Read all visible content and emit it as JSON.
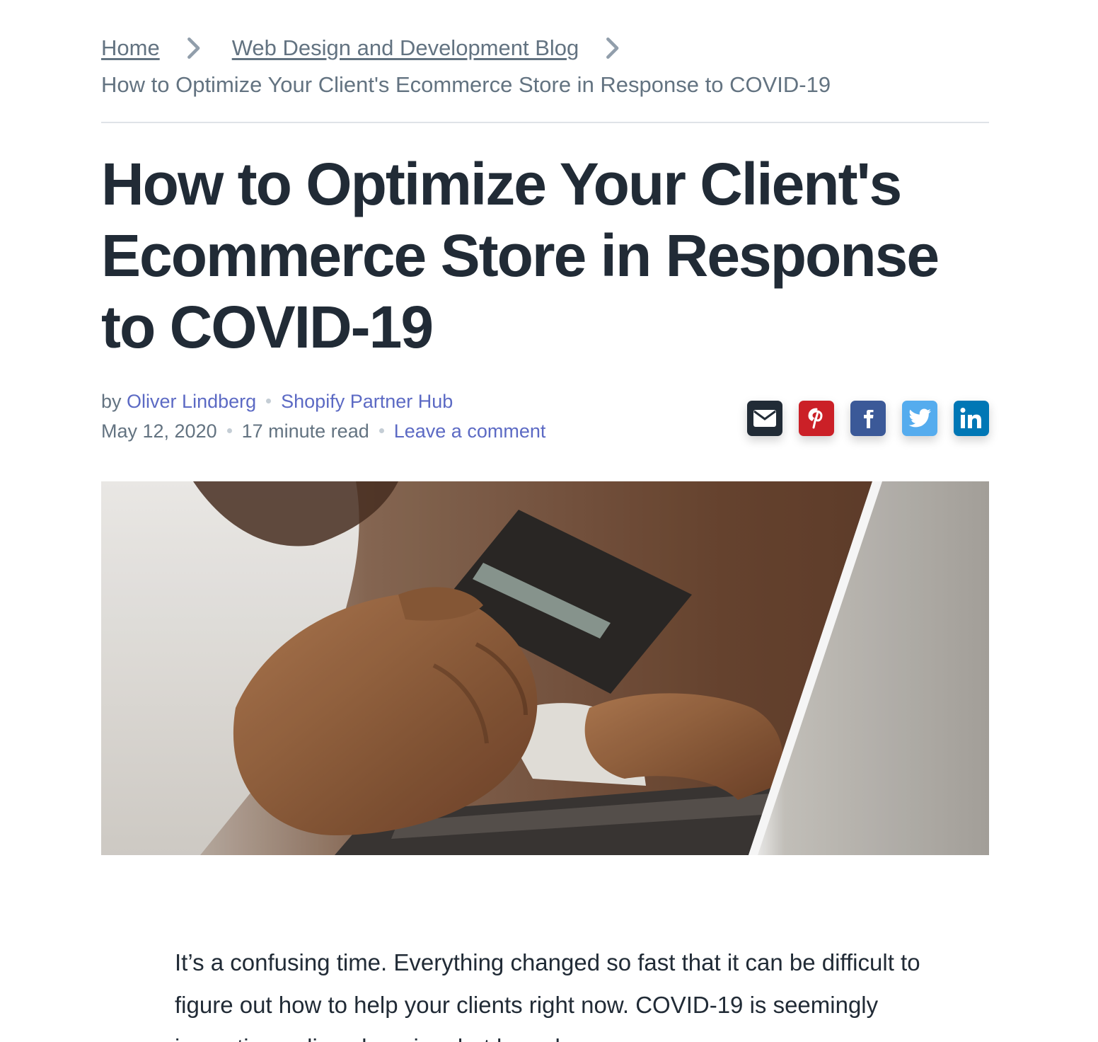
{
  "breadcrumb": {
    "home": "Home",
    "blog": "Web Design and Development Blog",
    "current": "How to Optimize Your Client's Ecommerce Store in Response to COVID-19"
  },
  "article": {
    "title": "How to Optimize Your Client's Ecommerce Store in Response to COVID-19",
    "by_prefix": "by",
    "author": "Oliver Lindberg",
    "publication": "Shopify Partner Hub",
    "date": "May 12, 2020",
    "read_time": "17 minute read",
    "comment_link": "Leave a comment",
    "body_intro": "It’s a confusing time. Everything changed so fast that it can be difficult to figure out how to help your clients right now. COVID-19 is seemingly impacting online shopping, but based on"
  },
  "share": [
    {
      "name": "email",
      "icon": "envelope-icon",
      "color": "#212b36"
    },
    {
      "name": "pinterest",
      "icon": "pinterest-icon",
      "color": "#cb2027"
    },
    {
      "name": "facebook",
      "icon": "facebook-icon",
      "color": "#3b5998"
    },
    {
      "name": "twitter",
      "icon": "twitter-icon",
      "color": "#55acee"
    },
    {
      "name": "linkedin",
      "icon": "linkedin-icon",
      "color": "#0077b5"
    }
  ],
  "colors": {
    "link": "#5c6ac4",
    "text_muted": "#637381",
    "heading": "#212b36"
  }
}
